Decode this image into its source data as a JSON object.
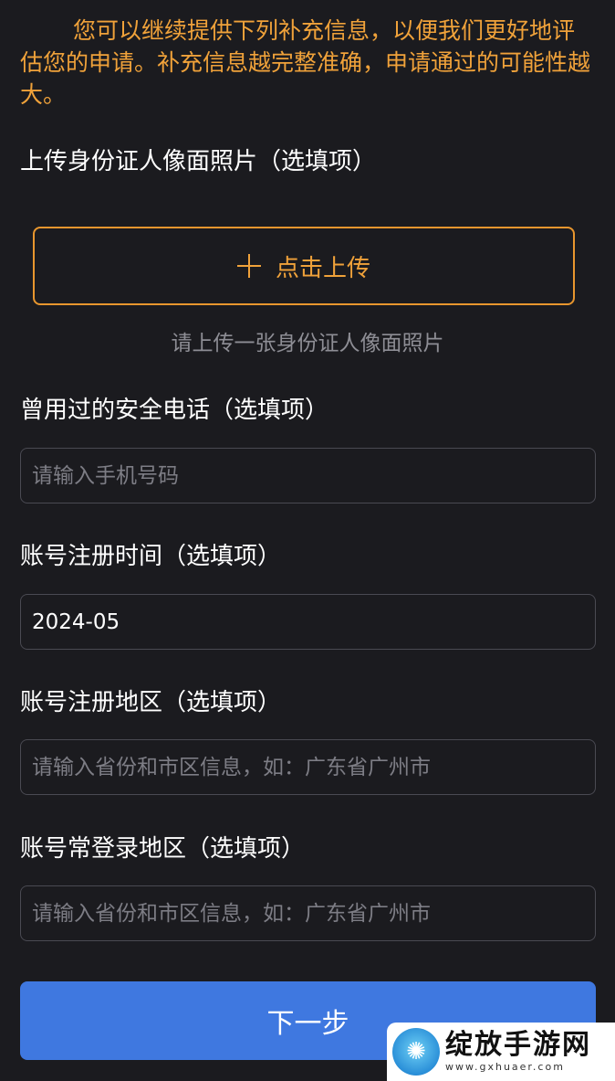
{
  "notice": "您可以继续提供下列补充信息，以便我们更好地评估您的申请。补充信息越完整准确，申请通过的可能性越大。",
  "id_photo": {
    "label": "上传身份证人像面照片（选填项）",
    "upload_label": "点击上传",
    "hint": "请上传一张身份证人像面照片"
  },
  "safe_phone": {
    "label": "曾用过的安全电话（选填项）",
    "placeholder": "请输入手机号码",
    "value": ""
  },
  "register_time": {
    "label": "账号注册时间（选填项）",
    "value": "2024-05"
  },
  "register_region": {
    "label": "账号注册地区（选填项）",
    "placeholder": "请输入省份和市区信息，如：广东省广州市",
    "value": ""
  },
  "login_region": {
    "label": "账号常登录地区（选填项）",
    "placeholder": "请输入省份和市区信息，如：广东省广州市",
    "value": ""
  },
  "next_label": "下一步",
  "watermark": {
    "title": "绽放手游网",
    "url": "www.gxhuaer.com",
    "logo_icon": "octopus-icon"
  },
  "colors": {
    "background": "#1b1b1f",
    "accent_orange": "#f0a23a",
    "primary_blue": "#3f78e0"
  }
}
